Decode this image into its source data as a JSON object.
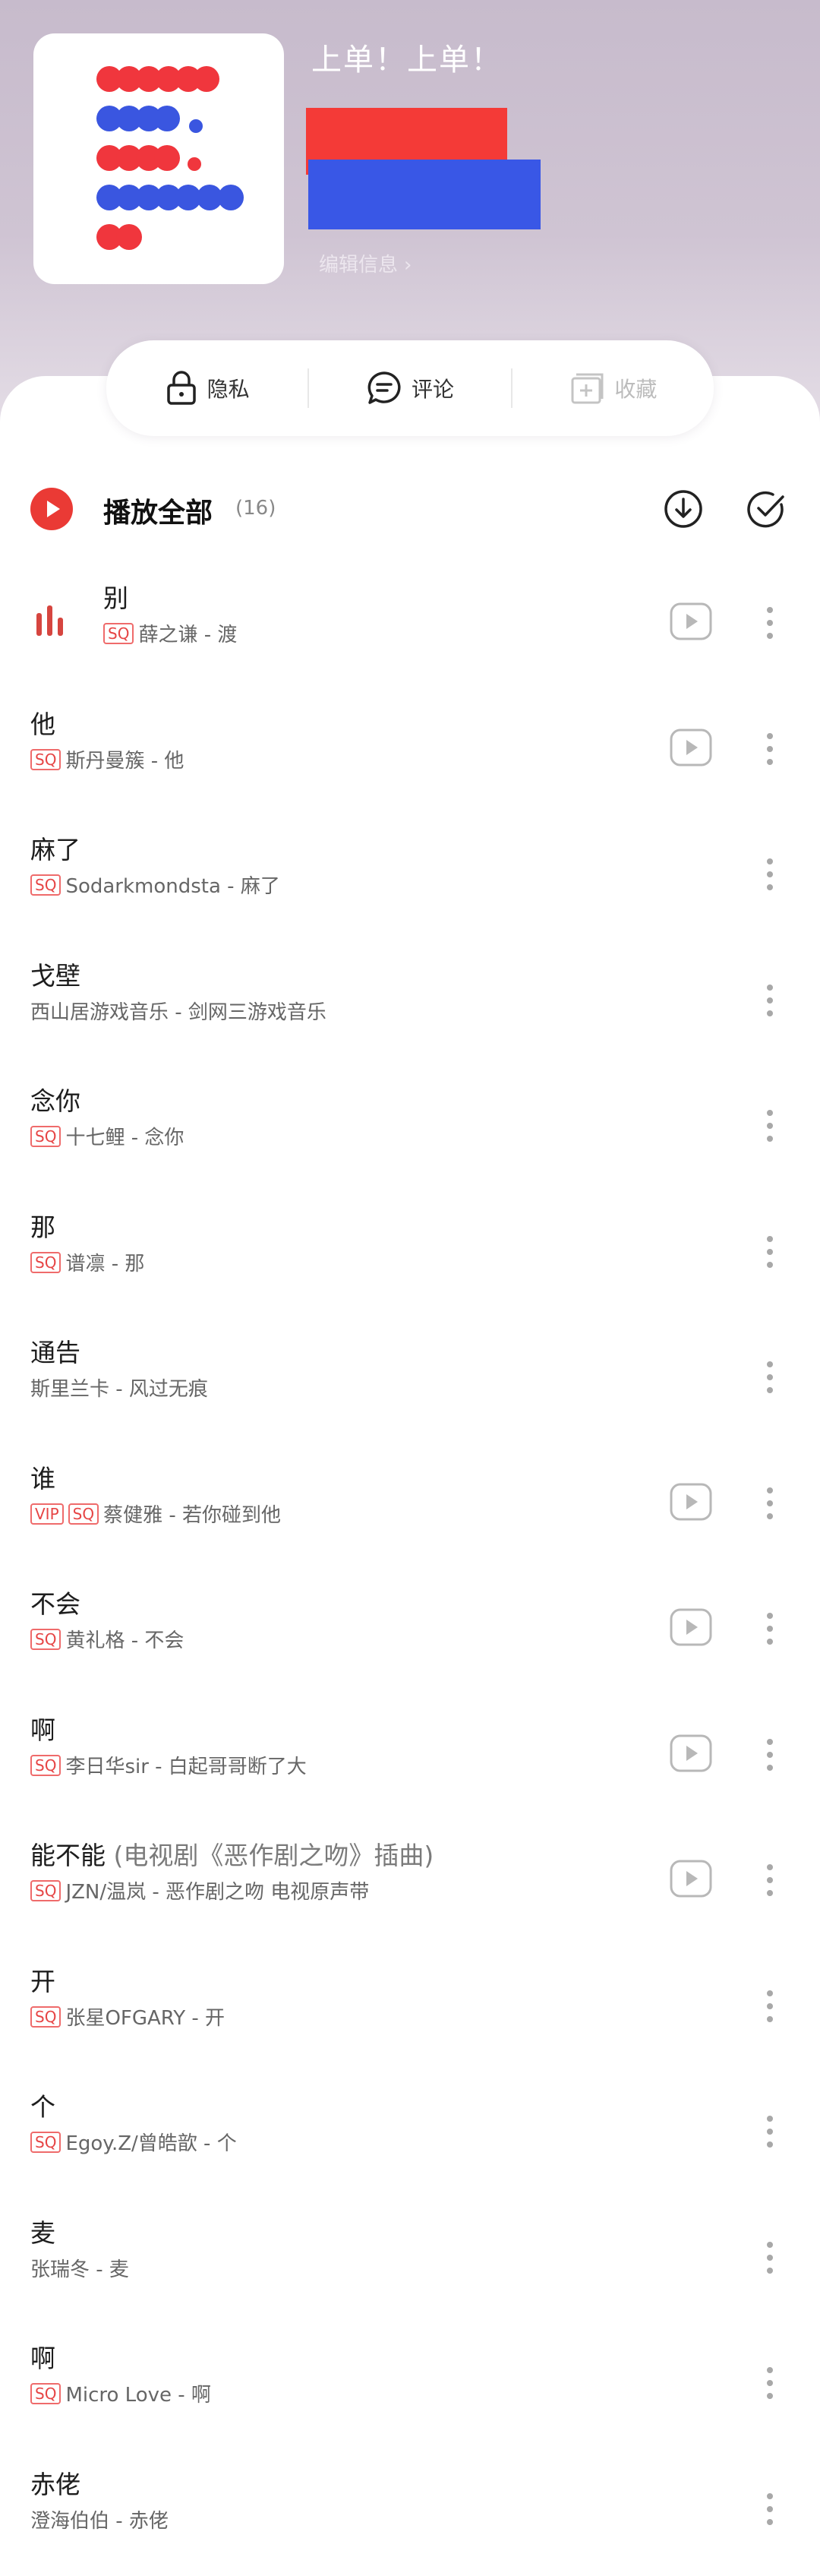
{
  "header": {
    "title": "上单！上单！",
    "edit_info": "编辑信息",
    "cover_colors": [
      "#f0363d",
      "#3a56e0"
    ]
  },
  "actions": {
    "privacy": "隐私",
    "comment": "评论",
    "collect": "收藏"
  },
  "play_all": {
    "label": "播放全部",
    "count": "(16)"
  },
  "songs": [
    {
      "title": "别",
      "extra": "",
      "vip": false,
      "sq": true,
      "meta": "薛之谦 - 渡",
      "playing": true,
      "mv": true
    },
    {
      "title": "他",
      "extra": "",
      "vip": false,
      "sq": true,
      "meta": "斯丹曼簇 - 他",
      "playing": false,
      "mv": true
    },
    {
      "title": "麻了",
      "extra": "",
      "vip": false,
      "sq": true,
      "meta": "Sodarkmondsta - 麻了",
      "playing": false,
      "mv": false
    },
    {
      "title": "戈壁",
      "extra": "",
      "vip": false,
      "sq": false,
      "meta": "西山居游戏音乐 - 剑网三游戏音乐",
      "playing": false,
      "mv": false
    },
    {
      "title": "念你",
      "extra": "",
      "vip": false,
      "sq": true,
      "meta": "十七鲤 - 念你",
      "playing": false,
      "mv": false
    },
    {
      "title": "那",
      "extra": "",
      "vip": false,
      "sq": true,
      "meta": "谱凛 - 那",
      "playing": false,
      "mv": false
    },
    {
      "title": "通告",
      "extra": "",
      "vip": false,
      "sq": false,
      "meta": "斯里兰卡 - 风过无痕",
      "playing": false,
      "mv": false
    },
    {
      "title": "谁",
      "extra": "",
      "vip": true,
      "sq": true,
      "meta": "蔡健雅 - 若你碰到他",
      "playing": false,
      "mv": true
    },
    {
      "title": "不会",
      "extra": "",
      "vip": false,
      "sq": true,
      "meta": "黄礼格 - 不会",
      "playing": false,
      "mv": true
    },
    {
      "title": "啊",
      "extra": "",
      "vip": false,
      "sq": true,
      "meta": "李日华sir - 白起哥哥断了大",
      "playing": false,
      "mv": true
    },
    {
      "title": "能不能",
      "extra": "(电视剧《恶作剧之吻》插曲)",
      "vip": false,
      "sq": true,
      "meta": "JZN/温岚 - 恶作剧之吻 电视原声带",
      "playing": false,
      "mv": true
    },
    {
      "title": "开",
      "extra": "",
      "vip": false,
      "sq": true,
      "meta": "张星OFGARY - 开",
      "playing": false,
      "mv": false
    },
    {
      "title": "个",
      "extra": "",
      "vip": false,
      "sq": true,
      "meta": "Egoy.Z/曾皓歆 - 个",
      "playing": false,
      "mv": false
    },
    {
      "title": "麦",
      "extra": "",
      "vip": false,
      "sq": false,
      "meta": "张瑞冬 - 麦",
      "playing": false,
      "mv": false
    },
    {
      "title": "啊",
      "extra": "",
      "vip": false,
      "sq": true,
      "meta": "Micro Love - 啊",
      "playing": false,
      "mv": false
    },
    {
      "title": "赤佬",
      "extra": "",
      "vip": false,
      "sq": false,
      "meta": "澄海伯伯 - 赤佬",
      "playing": false,
      "mv": false
    }
  ],
  "badges": {
    "vip": "VIP",
    "sq": "SQ"
  },
  "colors": {
    "accent": "#ea3a35",
    "badge": "#e64545"
  }
}
